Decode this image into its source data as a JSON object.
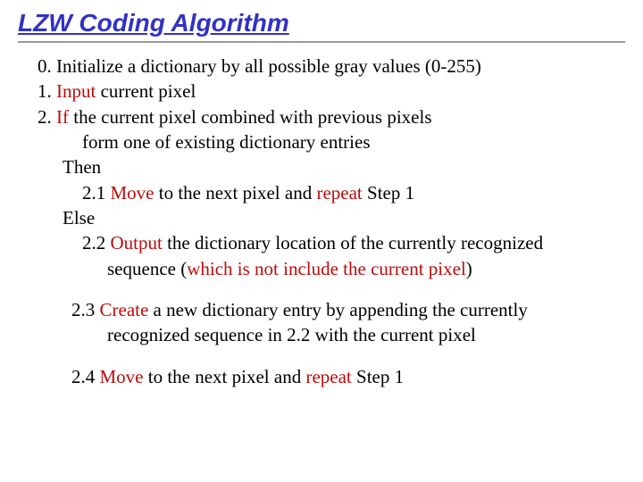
{
  "title": "LZW Coding Algorithm",
  "steps": {
    "s0_a": "0. Initialize ",
    "s0_b": "a dictionary by all possible gray values (0-255)",
    "s1_a": "1. ",
    "s1_b": "Input",
    "s1_c": " current pixel",
    "s2_a": "2. ",
    "s2_b": "If",
    "s2_c": " the current pixel combined with previous pixels",
    "s2_line2": "form one of existing dictionary entries",
    "then": "Then",
    "s21_a": "2.1 ",
    "s21_b": "Move",
    "s21_c": " to the next pixel and ",
    "s21_d": "repeat",
    "s21_e": " Step 1",
    "else": "Else",
    "s22_a": "2.2 ",
    "s22_b": "Output",
    "s22_c": " the dictionary location of the currently recognized",
    "s22_line2a": "sequence (",
    "s22_line2b": "which is not include the current pixel",
    "s22_line2c": ")",
    "s23_a": "2.3 ",
    "s23_b": "Create",
    "s23_c": " a new dictionary entry by appending the currently",
    "s23_line2": "recognized sequence in 2.2 with the current pixel",
    "s24_a": "2.4 ",
    "s24_b": "Move",
    "s24_c": " to the next pixel and ",
    "s24_d": "repeat",
    "s24_e": " Step 1"
  }
}
